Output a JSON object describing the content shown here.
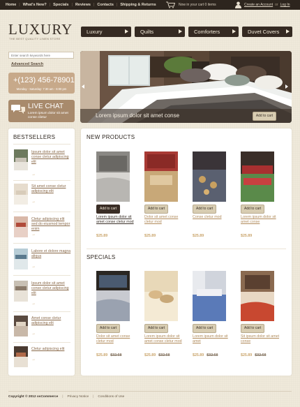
{
  "topnav": {
    "items": [
      "Home",
      "What's New?",
      "Specials",
      "Reviews",
      "Contacts",
      "Shipping & Returns"
    ],
    "cart_text": "Now in your cart 0 items",
    "create_account": "Create an Account",
    "or": "or",
    "login": "Log In"
  },
  "logo": {
    "text": "LUXURY",
    "tagline": "THE BEST QUALITY LINEN STORE"
  },
  "mainnav": [
    "Luxury",
    "Quilts",
    "Comforters",
    "Duvet Covers"
  ],
  "search": {
    "placeholder": "Enter search keywords here",
    "advanced": "Advanced Search"
  },
  "phone": {
    "number": "+(123) 456-78901",
    "hours": "Monday - Saturday: 7:30 am - 6:00 pm"
  },
  "livechat": {
    "title": "LIVE CHAT",
    "text": "Lorem ipsum dolor sit amet conse clietur"
  },
  "slider": {
    "caption": "Lorem ipsum dolor sit amet conse",
    "button": "Add to cart"
  },
  "bestsellers": {
    "title": "BESTSELLERS",
    "items": [
      {
        "name": "Ipsum dolor sit amet conse cletur adipiscing elit"
      },
      {
        "name": "Sit amet conse cletur adipiscing elit"
      },
      {
        "name": "Cletur adipiscing elit sed do eiusmod tempor enim"
      },
      {
        "name": "Labore et dolore magna aliqua"
      },
      {
        "name": "Ipsum dolor sit amet conse cletur adipiscing elit"
      },
      {
        "name": "Amet conse cletur adipiscing elit"
      },
      {
        "name": "Cletur adipiscing elit"
      }
    ],
    "arrow": "→"
  },
  "new_products": {
    "title": "NEW PRODUCTS",
    "items": [
      {
        "button": "Add to cart",
        "name": "Lorem ipsum dolor sit amet conse cletur mod",
        "price": "$25.89"
      },
      {
        "button": "Add to cart",
        "name": "Dolor sit amet conse cletur mod",
        "price": "$25.89"
      },
      {
        "button": "Add to cart",
        "name": "Conse cletur mod",
        "price": "$25.89"
      },
      {
        "button": "Add to cart",
        "name": "Lorem ipsum dolor sit amet conse",
        "price": "$25.89"
      }
    ]
  },
  "specials": {
    "title": "SPECIALS",
    "items": [
      {
        "button": "Add to cart",
        "name": "Dolor sit amet conse cletur mod",
        "price": "$25.89",
        "old_price": "$32.68"
      },
      {
        "button": "Add to cart",
        "name": "Lorem ipsum dolor sit amet conse cletur mod",
        "price": "$25.89",
        "old_price": "$32.68"
      },
      {
        "button": "Add to cart",
        "name": "Lorem ipsum dolor sit amet",
        "price": "$25.89",
        "old_price": "$32.68"
      },
      {
        "button": "Add to cart",
        "name": "Sit ipsum dolor sit amet conse",
        "price": "$25.89",
        "old_price": "$32.68"
      }
    ]
  },
  "footer": {
    "copyright": "Copyright © 2012 osCommerce",
    "privacy": "Privacy Notice",
    "sep": "|",
    "conditions": "Conditions of Use"
  },
  "colors": {
    "topbar": "#2d251e",
    "nav": "#352a22",
    "accent": "#c9a46a",
    "phone_bg": "#c7a98a",
    "chat_bg": "#a88a6c"
  }
}
